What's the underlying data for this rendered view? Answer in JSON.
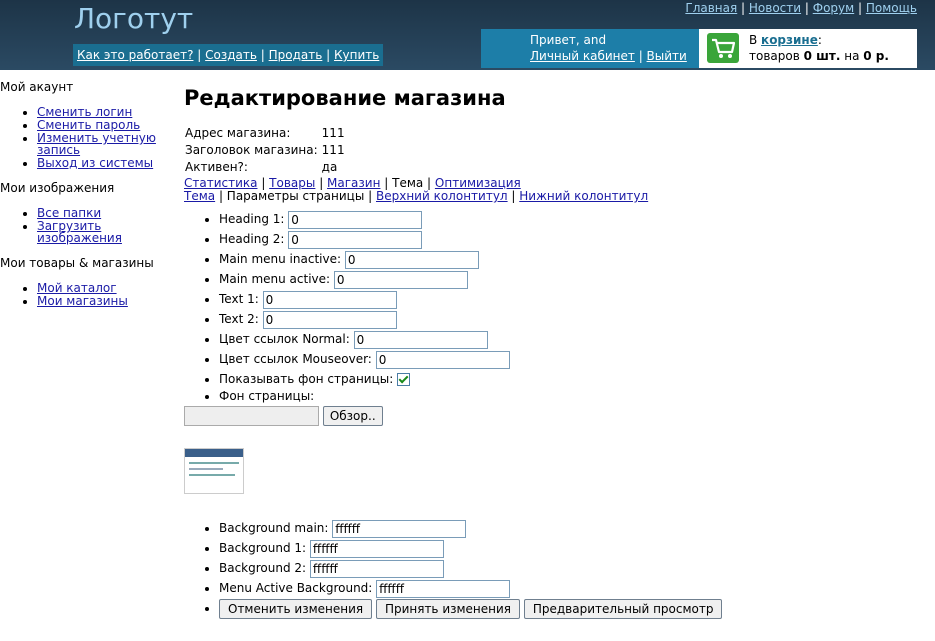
{
  "header": {
    "logo": "Логотут",
    "top_nav": [
      "Главная",
      "Новости",
      "Форум",
      "Помощь"
    ],
    "main_nav": [
      "Как это работает?",
      "Создать",
      "Продать",
      "Купить"
    ],
    "greeting": "Привет, and",
    "cabinet_link": "Личный кабинет",
    "logout_link": "Выйти",
    "cart_prefix": "В ",
    "cart_link": "корзине",
    "cart_colon": ":",
    "cart_goods": "товаров ",
    "cart_qty": "0 шт.",
    "cart_on": " на ",
    "cart_sum": "0 р."
  },
  "sidebar": {
    "account_title": "Мой акаунт",
    "account_items": [
      "Сменить логин",
      "Сменить пароль",
      "Изменить учетную запись",
      "Выход из системы"
    ],
    "images_title": "Мои изображения",
    "images_items": [
      "Все папки",
      "Загрузить изображения"
    ],
    "goods_title": "Мои товары & магазины",
    "goods_items": [
      "Мой каталог",
      "Мои магазины"
    ]
  },
  "main": {
    "title": "Редактирование магазина",
    "info": [
      {
        "label": "Адрес магазина:",
        "value": "111"
      },
      {
        "label": "Заголовок магазина:",
        "value": "111"
      },
      {
        "label": "Активен?:",
        "value": "да"
      }
    ],
    "tabs1": [
      "Статистика",
      "Товары",
      "Магазин",
      "Тема",
      "Оптимизация"
    ],
    "tabs2": [
      "Тема",
      "Параметры страницы",
      "Верхний колонтитул",
      "Нижний колонтитул"
    ],
    "fields": [
      {
        "label": "Heading 1:",
        "value": "0"
      },
      {
        "label": "Heading 2:",
        "value": "0"
      },
      {
        "label": "Main menu inactive:",
        "value": "0"
      },
      {
        "label": "Main menu active:",
        "value": "0"
      },
      {
        "label": "Text 1:",
        "value": "0"
      },
      {
        "label": "Text 2:",
        "value": "0"
      },
      {
        "label": "Цвет ссылок Normal:",
        "value": "0"
      },
      {
        "label": "Цвет ссылок Mouseover:",
        "value": "0"
      }
    ],
    "show_bg_label": "Показывать фон страницы:",
    "show_bg_checked": true,
    "bg_label": "Фон страницы:",
    "browse_button": "Обзор..",
    "bg_fields": [
      {
        "label": "Background main:",
        "value": "ffffff"
      },
      {
        "label": "Background 1:",
        "value": "ffffff"
      },
      {
        "label": "Background 2:",
        "value": "ffffff"
      },
      {
        "label": "Menu Active Background:",
        "value": "ffffff"
      }
    ],
    "buttons": [
      "Отменить изменения",
      "Принять изменения",
      "Предварительный просмотр"
    ]
  }
}
